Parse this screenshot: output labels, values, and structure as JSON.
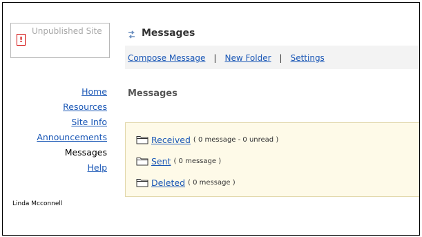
{
  "site_status": {
    "label": "Unpublished Site",
    "icon": "warning-icon",
    "icon_glyph": "!",
    "icon_color": "#d00000"
  },
  "sidebar": {
    "items": [
      {
        "label": "Home",
        "current": false
      },
      {
        "label": "Resources",
        "current": false
      },
      {
        "label": "Site Info",
        "current": false
      },
      {
        "label": "Announcements",
        "current": false
      },
      {
        "label": "Messages",
        "current": true
      },
      {
        "label": "Help",
        "current": false
      }
    ],
    "user_name": "Linda Mcconnell"
  },
  "tool": {
    "title": "Messages",
    "icon": "refresh-icon",
    "accent_color": "#6b9fd6"
  },
  "toolbar": {
    "compose_label": "Compose Message",
    "new_folder_label": "New Folder",
    "settings_label": "Settings",
    "separator": "|"
  },
  "main": {
    "section_title": "Messages",
    "folders": [
      {
        "name": "Received",
        "count": "( 0 message - 0 unread )",
        "icon": "folder-icon"
      },
      {
        "name": "Sent",
        "count": "( 0 message )",
        "icon": "folder-icon"
      },
      {
        "name": "Deleted",
        "count": "( 0 message )",
        "icon": "folder-icon"
      }
    ]
  },
  "colors": {
    "link": "#1a57b6",
    "folder_panel_bg": "#fefae8",
    "toolbar_bg": "#f3f3f3"
  }
}
